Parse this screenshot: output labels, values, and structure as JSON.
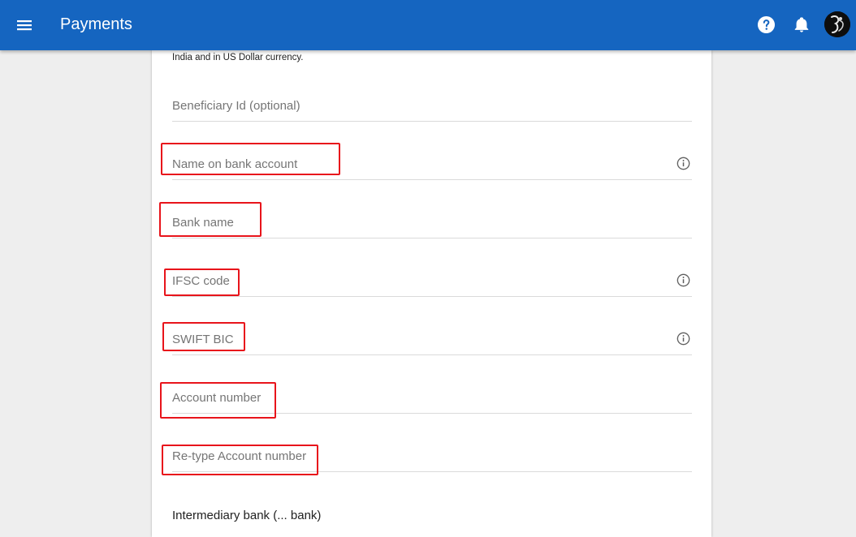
{
  "app_bar": {
    "title": "Payments",
    "menu_icon": "hamburger-menu-icon",
    "help_icon": "help-circle-icon",
    "notifications_icon": "bell-icon",
    "background_color": "#1565c0"
  },
  "form": {
    "intro_text": "India and in US Dollar currency.",
    "fields": [
      {
        "label": "Beneficiary Id (optional)",
        "value": "",
        "has_info_icon": false,
        "highlighted": false
      },
      {
        "label": "Name on bank account",
        "value": "",
        "has_info_icon": true,
        "highlighted": true
      },
      {
        "label": "Bank name",
        "value": "",
        "has_info_icon": false,
        "highlighted": true
      },
      {
        "label": "IFSC code",
        "value": "",
        "has_info_icon": true,
        "highlighted": true
      },
      {
        "label": "SWIFT BIC",
        "value": "",
        "has_info_icon": true,
        "highlighted": true
      },
      {
        "label": "Account number",
        "value": "",
        "has_info_icon": false,
        "highlighted": true
      },
      {
        "label": "Re-type Account number",
        "value": "",
        "has_info_icon": false,
        "highlighted": true
      }
    ],
    "next_label_partial": "Intermediary bank (... bank)"
  },
  "colors": {
    "highlight_box": "#e8141b",
    "page_background": "#eeeeee",
    "card_background": "#ffffff"
  }
}
